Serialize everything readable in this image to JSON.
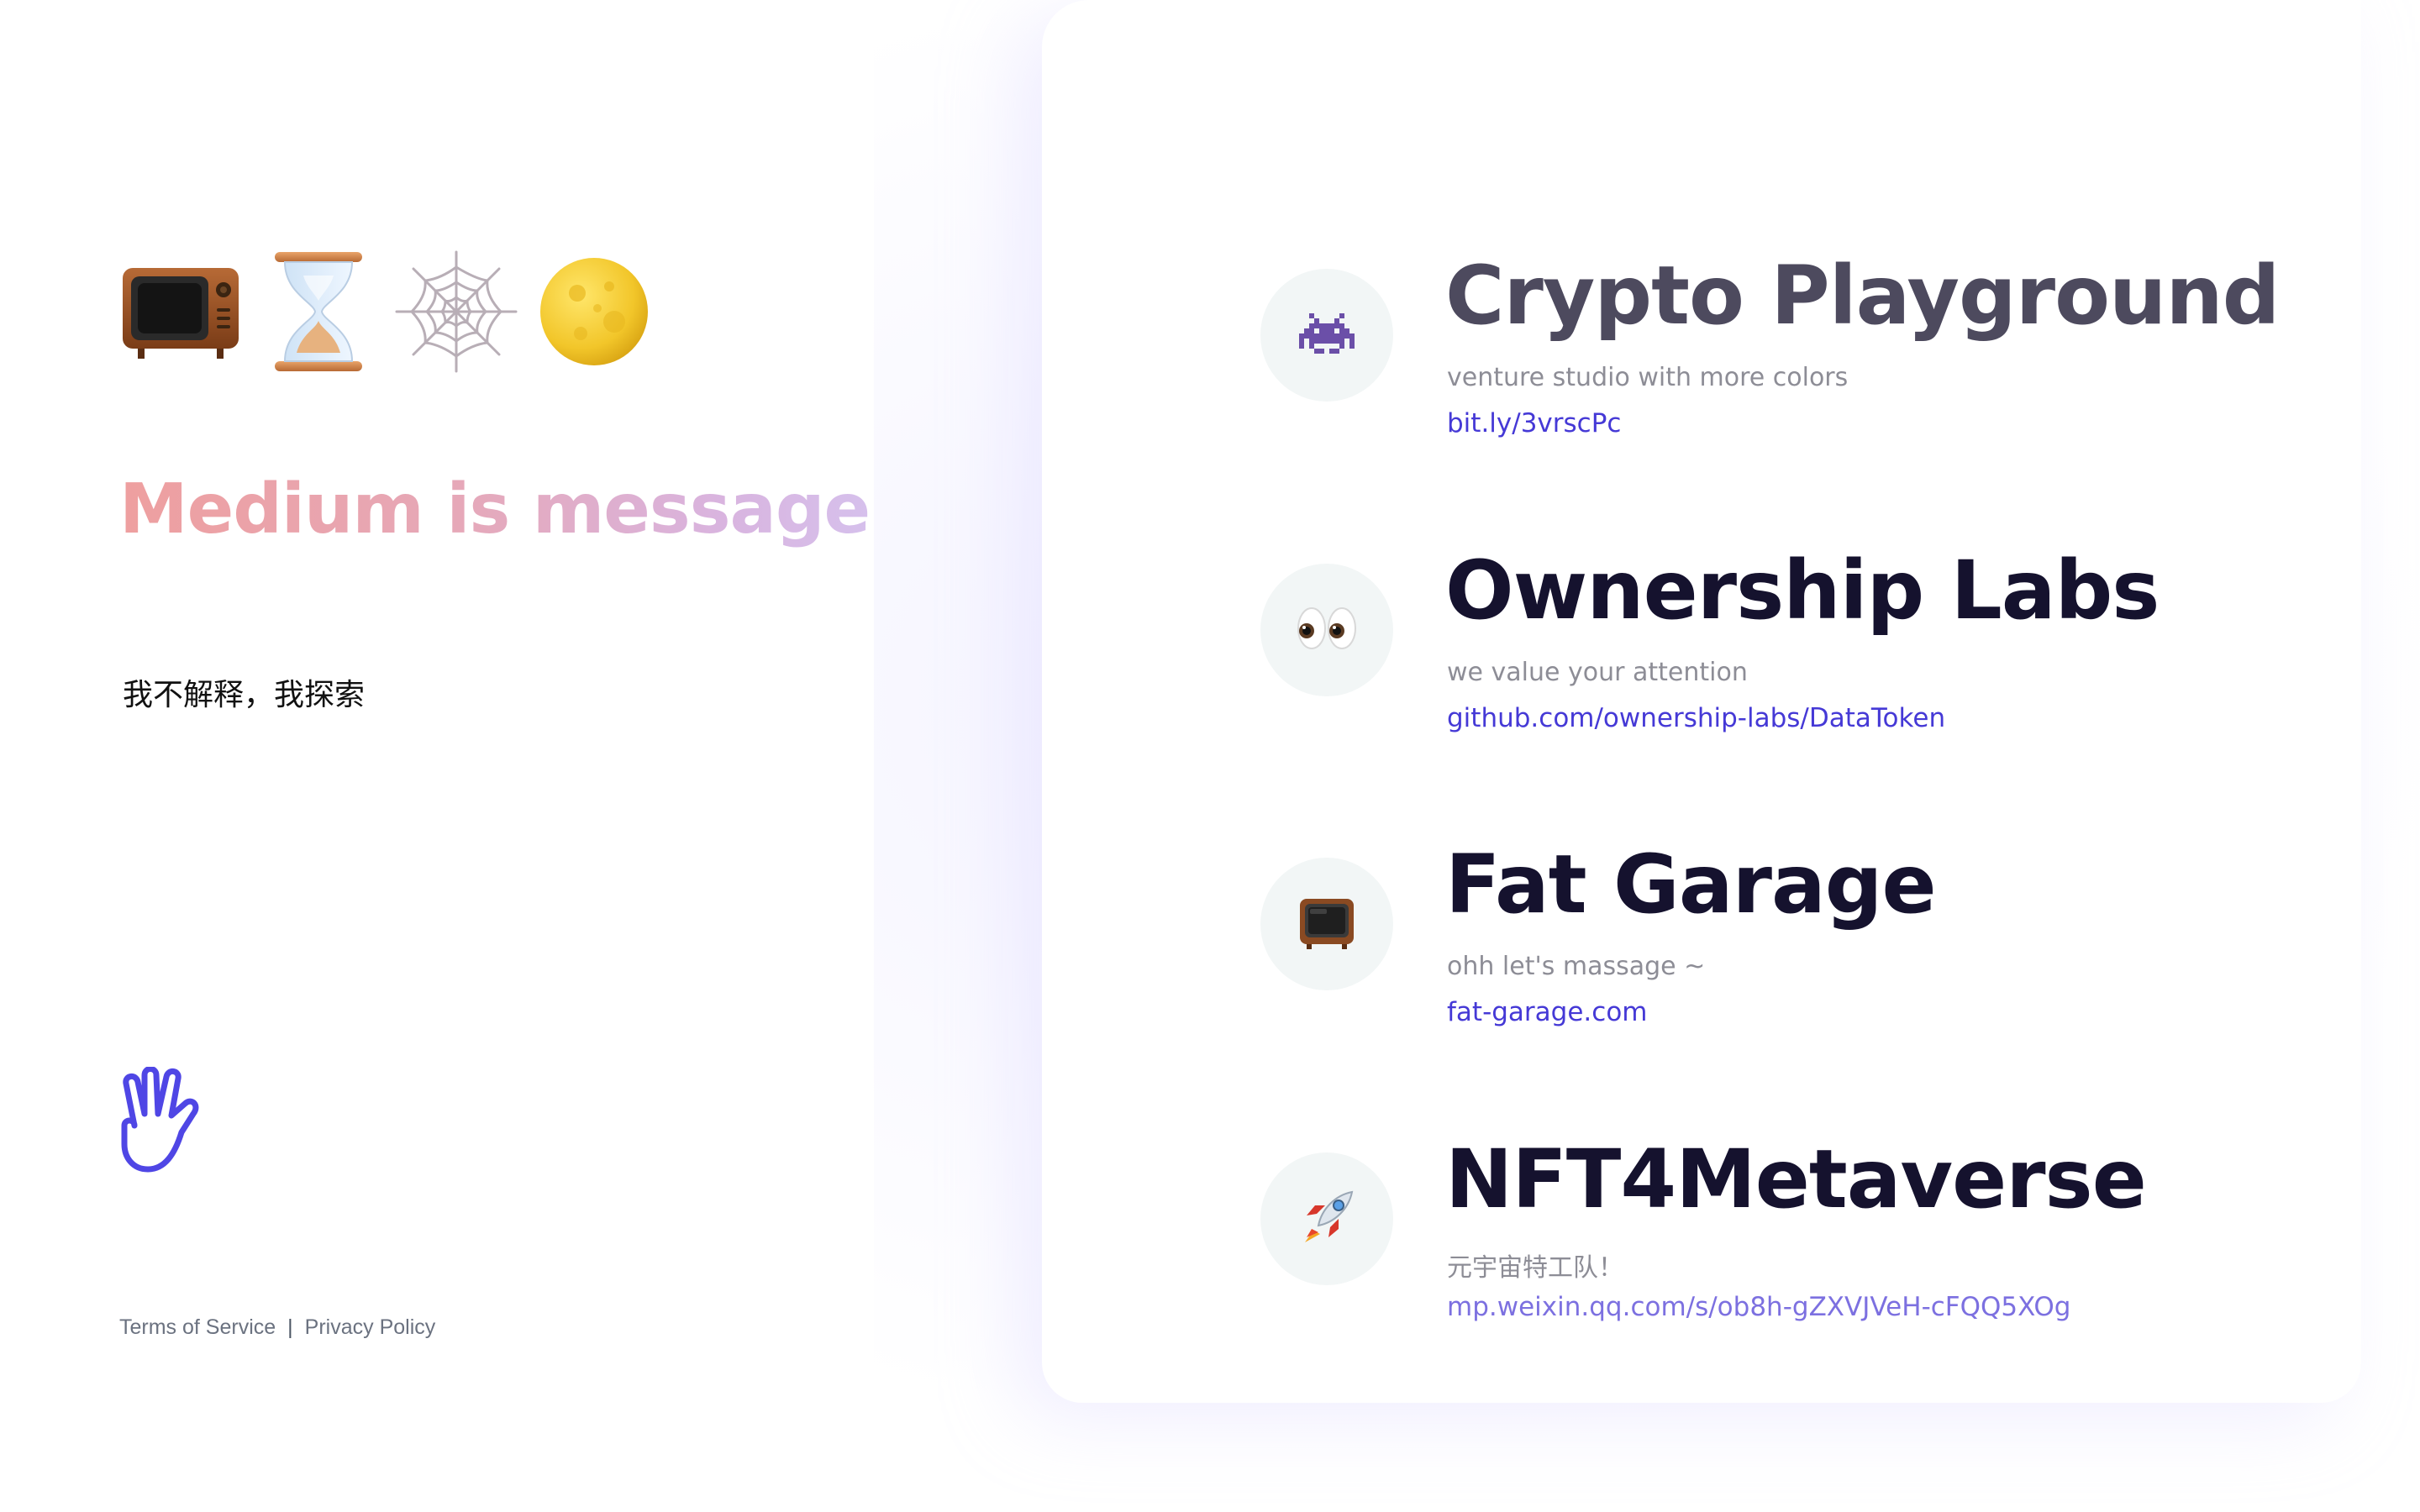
{
  "left": {
    "emojis": [
      {
        "icon": "television-icon"
      },
      {
        "icon": "hourglass-icon"
      },
      {
        "icon": "spider-web-icon"
      },
      {
        "icon": "full-moon-icon"
      }
    ],
    "tagline": "Medium is message",
    "motto": "我不解释，我探索",
    "hand_icon": "vulcan-salute-icon",
    "footer": {
      "terms": "Terms of Service",
      "separator": "|",
      "privacy": "Privacy Policy"
    }
  },
  "projects": [
    {
      "icon": "space-invader-icon",
      "title": "Crypto Playground",
      "subtitle": "venture studio with more colors",
      "link": "bit.ly/3vrscPc"
    },
    {
      "icon": "eyes-icon",
      "title": "Ownership Labs",
      "subtitle": "we value your attention",
      "link": "github.com/ownership-labs/DataToken"
    },
    {
      "icon": "television-icon",
      "title": "Fat Garage",
      "subtitle": "ohh let's massage ~",
      "link": "fat-garage.com"
    },
    {
      "icon": "rocket-icon",
      "title": "NFT4Metaverse",
      "subtitle": "元宇宙特工队！",
      "link": "mp.weixin.qq.com/s/ob8h-gZXVJVeH-cFQQ5XOg"
    }
  ],
  "colors": {
    "accent_link": "#4539d6",
    "title_dark": "#15122e",
    "tagline_start": "#ee9f9f",
    "tagline_end": "#d6c0ec",
    "hand_stroke": "#4f46e5"
  }
}
